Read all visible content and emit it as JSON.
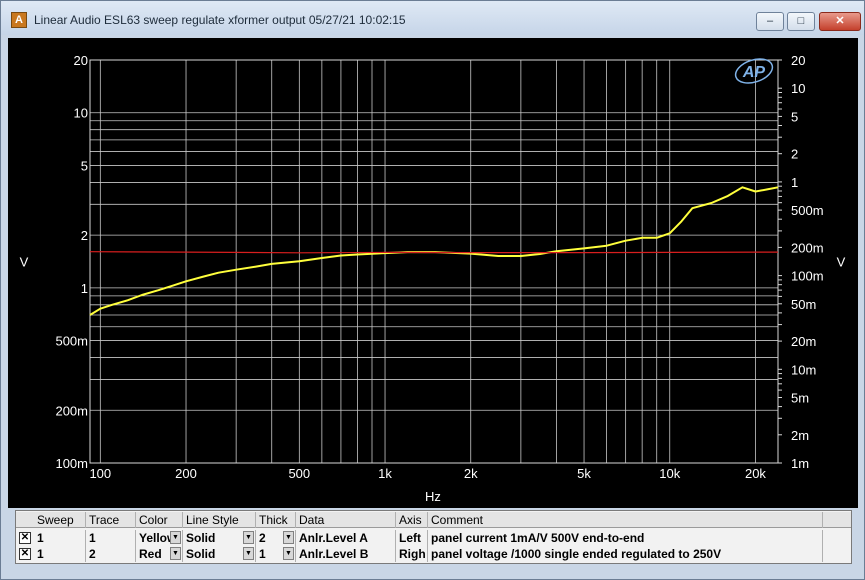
{
  "window": {
    "title": "Linear Audio  ESL63 sweep regulate xformer output  05/27/21 10:02:15",
    "app_icon": "ap-logo-icon",
    "controls": {
      "minimize": "–",
      "maximize": "□",
      "close": "✕"
    }
  },
  "chart_data": {
    "type": "line",
    "xlabel": "Hz",
    "ylabel_left": "V",
    "ylabel_right": "V",
    "x_scale": "log",
    "x_ticks": [
      "100",
      "200",
      "500",
      "1k",
      "2k",
      "5k",
      "10k",
      "20k"
    ],
    "x_tick_values": [
      100,
      200,
      500,
      1000,
      2000,
      5000,
      10000,
      20000
    ],
    "xlim": [
      92,
      24000
    ],
    "y_left_scale": "log",
    "y_left_ticks": [
      "20",
      "10",
      "5",
      "2",
      "1",
      "500m",
      "200m",
      "100m"
    ],
    "y_left_tick_values": [
      20,
      10,
      5,
      2,
      1,
      0.5,
      0.2,
      0.1
    ],
    "y_left_lim": [
      0.1,
      20
    ],
    "y_right_scale": "log",
    "y_right_ticks": [
      "20",
      "10",
      "5",
      "2",
      "1",
      "500m",
      "200m",
      "100m",
      "50m",
      "20m",
      "10m",
      "5m",
      "2m",
      "1m"
    ],
    "y_right_tick_values": [
      20,
      10,
      5,
      2,
      1,
      0.5,
      0.2,
      0.1,
      0.05,
      0.02,
      0.01,
      0.005,
      0.002,
      0.001
    ],
    "y_right_lim": [
      0.001,
      20
    ],
    "grid": true,
    "logo_text": "AP",
    "series": [
      {
        "name": "Anlr.Level A",
        "color": "#ffff3c",
        "axis": "left",
        "x": [
          92,
          100,
          110,
          125,
          140,
          160,
          180,
          200,
          230,
          260,
          300,
          350,
          400,
          500,
          600,
          700,
          800,
          1000,
          1200,
          1500,
          2000,
          2500,
          3000,
          3500,
          4000,
          5000,
          6000,
          7000,
          8000,
          9000,
          10000,
          11000,
          12000,
          14000,
          16000,
          18000,
          20000,
          22000,
          24000
        ],
        "y": [
          0.7,
          0.76,
          0.8,
          0.85,
          0.91,
          0.97,
          1.03,
          1.09,
          1.16,
          1.22,
          1.27,
          1.32,
          1.37,
          1.42,
          1.48,
          1.53,
          1.55,
          1.58,
          1.6,
          1.6,
          1.57,
          1.52,
          1.52,
          1.56,
          1.62,
          1.68,
          1.74,
          1.86,
          1.93,
          1.93,
          2.05,
          2.4,
          2.85,
          3.05,
          3.35,
          3.75,
          3.55,
          3.65,
          3.75
        ]
      },
      {
        "name": "Anlr.Level B",
        "color": "#d81e1e",
        "axis": "right",
        "x": [
          92,
          200,
          500,
          1000,
          2000,
          5000,
          10000,
          24000
        ],
        "y": [
          0.18,
          0.178,
          0.175,
          0.177,
          0.176,
          0.176,
          0.177,
          0.178
        ]
      }
    ]
  },
  "trace_panel": {
    "headers": [
      "Sweep",
      "Trace",
      "Color",
      "Line Style",
      "Thick",
      "Data",
      "Axis",
      "Comment"
    ],
    "rows": [
      {
        "checked": "✕",
        "sweep": "1",
        "trace": "1",
        "color": "Yellow",
        "line_style": "Solid",
        "thick": "2",
        "data": "Anlr.Level A",
        "axis": "Left",
        "comment": "panel current 1mA/V 500V end-to-end"
      },
      {
        "checked": "✕",
        "sweep": "1",
        "trace": "2",
        "color": "Red",
        "line_style": "Solid",
        "thick": "1",
        "data": "Anlr.Level B",
        "axis": "Righ",
        "comment": "panel voltage /1000 single ended regulated to 250V"
      }
    ]
  }
}
